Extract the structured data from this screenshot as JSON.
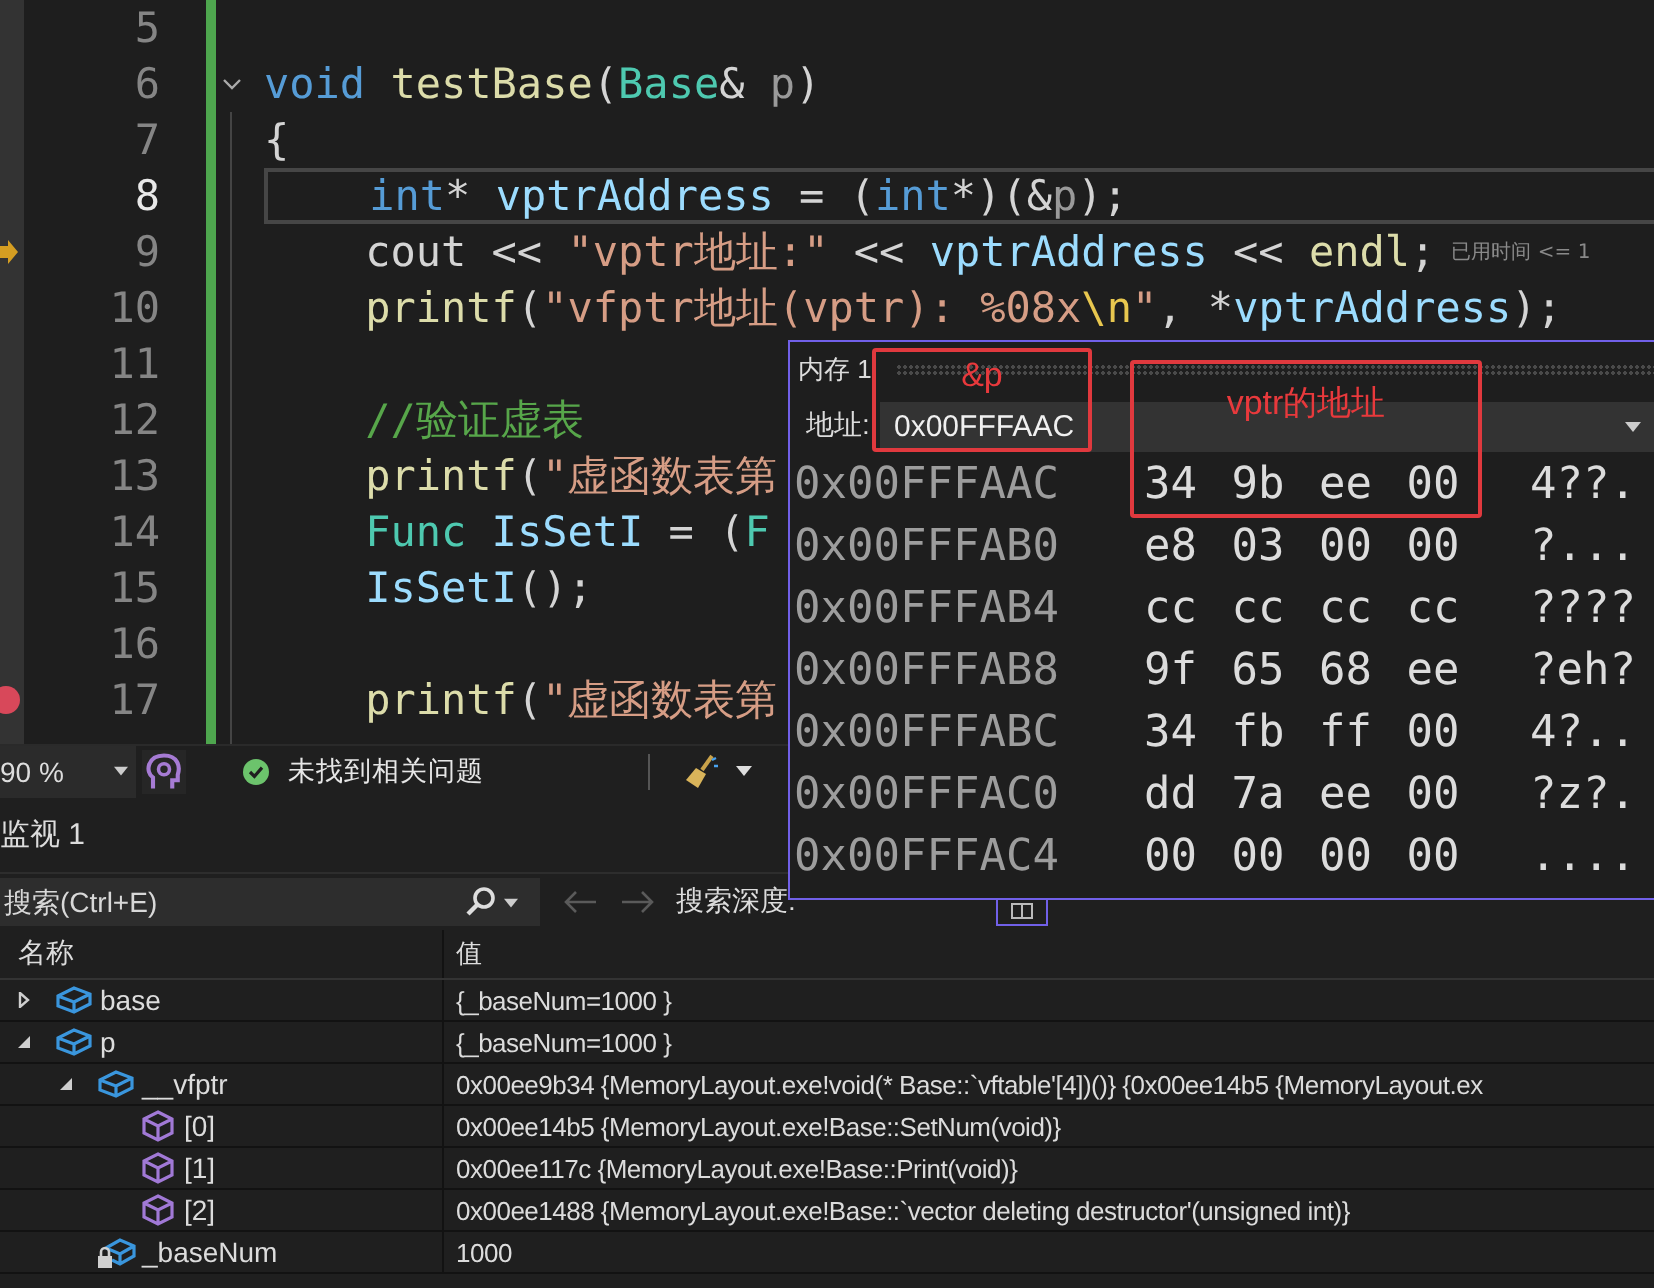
{
  "editor": {
    "lines": [
      {
        "number": "5",
        "highlighted": false
      },
      {
        "number": "6",
        "highlighted": false,
        "fold_expanded": true,
        "tokens": [
          {
            "kind": "keyword",
            "text": "void "
          },
          {
            "kind": "function",
            "text": "testBase"
          },
          {
            "kind": "plain",
            "text": "("
          },
          {
            "kind": "type",
            "text": "Base"
          },
          {
            "kind": "plain",
            "text": "& "
          },
          {
            "kind": "param",
            "text": "p"
          },
          {
            "kind": "plain",
            "text": ")"
          }
        ]
      },
      {
        "number": "7",
        "highlighted": false,
        "tokens": [
          {
            "kind": "plain",
            "text": "{"
          }
        ]
      },
      {
        "number": "8",
        "highlighted": true,
        "tokens": [
          {
            "kind": "keyword",
            "text": "    int"
          },
          {
            "kind": "plain",
            "text": "* "
          },
          {
            "kind": "variable",
            "text": "vptrAddress"
          },
          {
            "kind": "plain",
            "text": " = ("
          },
          {
            "kind": "keyword",
            "text": "int"
          },
          {
            "kind": "plain",
            "text": "*)(&"
          },
          {
            "kind": "param",
            "text": "p"
          },
          {
            "kind": "plain",
            "text": ");"
          }
        ]
      },
      {
        "number": "9",
        "highlighted": false,
        "current_statement": true,
        "hint": "已用时间 <= 1",
        "tokens": [
          {
            "kind": "plain",
            "text": "    cout << "
          },
          {
            "kind": "string",
            "text": "\"vptr地址:\""
          },
          {
            "kind": "plain",
            "text": " << "
          },
          {
            "kind": "variable",
            "text": "vptrAddress"
          },
          {
            "kind": "plain",
            "text": " << "
          },
          {
            "kind": "function",
            "text": "endl"
          },
          {
            "kind": "plain",
            "text": ";"
          }
        ]
      },
      {
        "number": "10",
        "highlighted": false,
        "tokens": [
          {
            "kind": "function",
            "text": "    printf"
          },
          {
            "kind": "plain",
            "text": "("
          },
          {
            "kind": "string",
            "text": "\"vfptr地址(vptr): %08x"
          },
          {
            "kind": "escape",
            "text": "\\n"
          },
          {
            "kind": "string",
            "text": "\""
          },
          {
            "kind": "plain",
            "text": ", *"
          },
          {
            "kind": "variable",
            "text": "vptrAddress"
          },
          {
            "kind": "plain",
            "text": ");"
          }
        ]
      },
      {
        "number": "11",
        "highlighted": false
      },
      {
        "number": "12",
        "highlighted": false,
        "tokens": [
          {
            "kind": "comment",
            "text": "    //验证虚表"
          }
        ]
      },
      {
        "number": "13",
        "highlighted": false,
        "tokens": [
          {
            "kind": "function",
            "text": "    printf"
          },
          {
            "kind": "plain",
            "text": "("
          },
          {
            "kind": "string",
            "text": "\"虚函数表第"
          }
        ]
      },
      {
        "number": "14",
        "highlighted": false,
        "tokens": [
          {
            "kind": "type",
            "text": "    Func "
          },
          {
            "kind": "variable",
            "text": "IsSetI"
          },
          {
            "kind": "plain",
            "text": " = ("
          },
          {
            "kind": "type",
            "text": "F"
          }
        ]
      },
      {
        "number": "15",
        "highlighted": false,
        "tokens": [
          {
            "kind": "variable",
            "text": "    IsSetI"
          },
          {
            "kind": "plain",
            "text": "();"
          }
        ]
      },
      {
        "number": "16",
        "highlighted": false
      },
      {
        "number": "17",
        "highlighted": false,
        "breakpoint": true,
        "tokens": [
          {
            "kind": "function",
            "text": "    printf"
          },
          {
            "kind": "plain",
            "text": "("
          },
          {
            "kind": "string",
            "text": "\"虚函数表第"
          }
        ]
      }
    ]
  },
  "status_bar": {
    "zoom": "90 %",
    "issues": "未找到相关问题"
  },
  "memory_window": {
    "title": "内存 1",
    "address_label": "地址:",
    "address": "0x00FFFAAC",
    "rows": [
      {
        "address": "0x00FFFAAC",
        "bytes": "34 9b ee 00",
        "ascii": "4??."
      },
      {
        "address": "0x00FFFAB0",
        "bytes": "e8 03 00 00",
        "ascii": "?..."
      },
      {
        "address": "0x00FFFAB4",
        "bytes": "cc cc cc cc",
        "ascii": "????"
      },
      {
        "address": "0x00FFFAB8",
        "bytes": "9f 65 68 ee",
        "ascii": "?eh?"
      },
      {
        "address": "0x00FFFABC",
        "bytes": "34 fb ff 00",
        "ascii": "4?.."
      },
      {
        "address": "0x00FFFAC0",
        "bytes": "dd 7a ee 00",
        "ascii": "?z?."
      },
      {
        "address": "0x00FFFAC4",
        "bytes": "00 00 00 00",
        "ascii": "...."
      }
    ]
  },
  "annotations": [
    {
      "text": "&p"
    },
    {
      "text": "vptr的地址"
    }
  ],
  "watch": {
    "title": "监视 1",
    "search_placeholder": "搜索(Ctrl+E)",
    "depth_label": "搜索深度:",
    "columns": [
      "名称",
      "值"
    ],
    "rows": [
      {
        "name": "base",
        "value": "{_baseNum=1000 }",
        "kind": "object",
        "expanded": false
      },
      {
        "name": "p",
        "value": "{_baseNum=1000 }",
        "kind": "object",
        "expanded": true,
        "children": [
          {
            "name": "__vfptr",
            "value": "0x00ee9b34 {MemoryLayout.exe!void(* Base::`vftable'[4])()} {0x00ee14b5 {MemoryLayout.ex",
            "kind": "object",
            "expanded": true,
            "children": [
              {
                "name": "[0]",
                "value": "0x00ee14b5 {MemoryLayout.exe!Base::SetNum(void)}",
                "kind": "method"
              },
              {
                "name": "[1]",
                "value": "0x00ee117c {MemoryLayout.exe!Base::Print(void)}",
                "kind": "method"
              },
              {
                "name": "[2]",
                "value": "0x00ee1488 {MemoryLayout.exe!Base::`vector deleting destructor'(unsigned int)}",
                "kind": "method"
              }
            ]
          },
          {
            "name": "_baseNum",
            "value": "1000",
            "kind": "private"
          }
        ]
      }
    ]
  }
}
